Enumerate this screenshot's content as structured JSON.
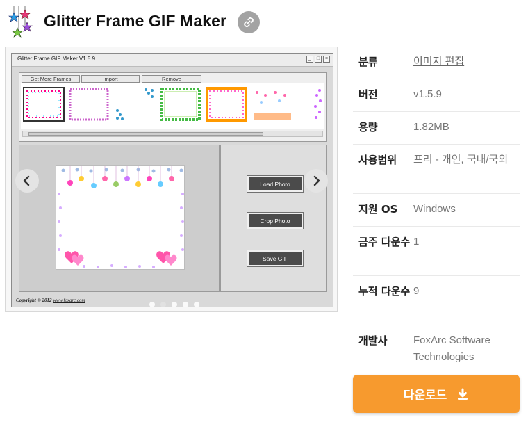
{
  "header": {
    "title": "Glitter Frame GIF Maker",
    "logo_icon": "star-ornaments-logo",
    "link_icon": "chain-link-icon"
  },
  "screenshot": {
    "window_title": "Glitter Frame GIF Maker V1.5.9",
    "tabs": [
      "Get More Frames",
      "Import",
      "Remove"
    ],
    "buttons": [
      "Load Photo",
      "Crop Photo",
      "Save GIF"
    ],
    "copyright_prefix": "Copyright © 2012 ",
    "copyright_link": "www.foxarc.com",
    "slide_count": 5,
    "active_slide": 1
  },
  "info": {
    "rows": [
      {
        "label": "분류",
        "value": "이미지 편집",
        "is_link": true
      },
      {
        "label": "버전",
        "value": "v1.5.9"
      },
      {
        "label": "용량",
        "value": "1.82MB"
      },
      {
        "label": "사용범위",
        "value": "프리 - 개인, 국내/국외"
      },
      {
        "label": "지원 OS",
        "value": "Windows"
      },
      {
        "label": "금주 다운수",
        "value": "1"
      },
      {
        "label": "누적 다운수",
        "value": "9"
      },
      {
        "label": "개발사",
        "value": "FoxArc Software Technologies"
      }
    ]
  },
  "download": {
    "label": "다운로드",
    "icon": "download-icon"
  },
  "colors": {
    "download_bg": "#f79a2e",
    "link_btn_bg": "#a3a3a3",
    "app_button_bg": "#4b4b4b"
  }
}
